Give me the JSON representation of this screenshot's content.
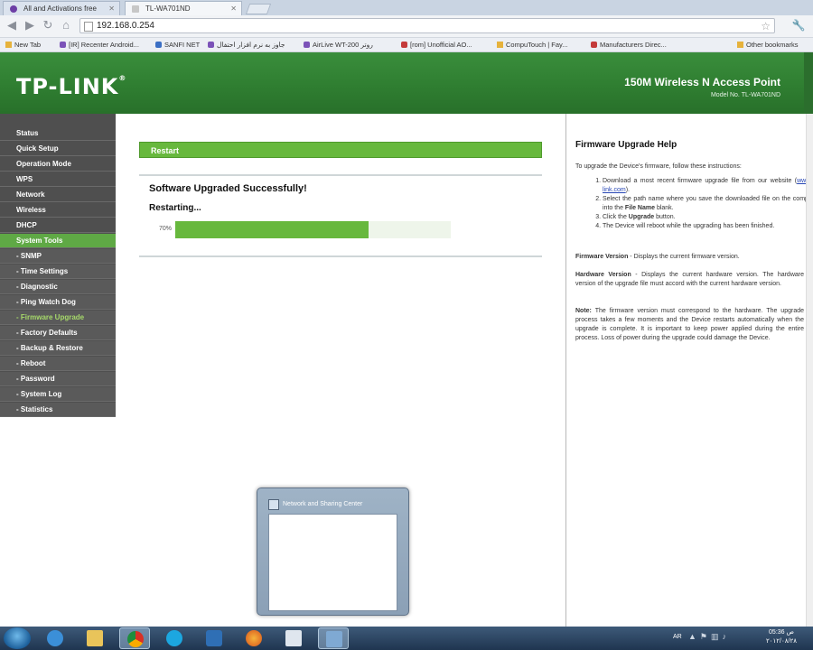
{
  "browser": {
    "tabs": [
      {
        "label": "All and Activations free"
      },
      {
        "label": "TL-WA701ND"
      }
    ],
    "address": "192.168.0.254",
    "bookmarks": [
      {
        "label": "New Tab"
      },
      {
        "label": "[IR] Recenter Android..."
      },
      {
        "label": "SANFI NET"
      },
      {
        "label": "جاوز به نرم افزار احتفال"
      },
      {
        "label": "AirLive WT-200 روتر"
      },
      {
        "label": "[rom] Unofficial AO..."
      },
      {
        "label": "CompuTouch | Fay..."
      },
      {
        "label": "Manufacturers Direc..."
      },
      {
        "label": "Other bookmarks"
      }
    ]
  },
  "header": {
    "logo": "TP-LINK",
    "product": "150M Wireless N Access Point",
    "model": "Model No. TL-WA701ND"
  },
  "sidebar": {
    "items": [
      {
        "label": "Status"
      },
      {
        "label": "Quick Setup"
      },
      {
        "label": "Operation Mode"
      },
      {
        "label": "WPS"
      },
      {
        "label": "Network"
      },
      {
        "label": "Wireless"
      },
      {
        "label": "DHCP"
      },
      {
        "label": "System Tools"
      },
      {
        "label": "- SNMP"
      },
      {
        "label": "- Time Settings"
      },
      {
        "label": "- Diagnostic"
      },
      {
        "label": "- Ping Watch Dog"
      },
      {
        "label": "- Firmware Upgrade"
      },
      {
        "label": "- Factory Defaults"
      },
      {
        "label": "- Backup & Restore"
      },
      {
        "label": "- Reboot"
      },
      {
        "label": "- Password"
      },
      {
        "label": "- System Log"
      },
      {
        "label": "- Statistics"
      }
    ]
  },
  "main": {
    "section_title": "Restart",
    "message": "Software Upgraded Successfully!",
    "status": "Restarting...",
    "progress_label": "70%",
    "progress": 0.7
  },
  "help": {
    "title": "Firmware Upgrade Help",
    "intro": "To upgrade the Device's firmware, follow these instructions:",
    "step1_a": "Download a most recent firmware upgrade file from our website (",
    "step1_link": "www.tp-link.com",
    "step1_b": ").",
    "step2_a": "Select the path name where you save the downloaded file on the computer into the ",
    "step2_bold": "File Name",
    "step2_b": " blank.",
    "step3_a": "Click the ",
    "step3_bold": "Upgrade",
    "step3_b": " button.",
    "step4": "The Device will reboot while the upgrading has been finished.",
    "fw_label": "Firmware Version",
    "fw_text": " - Displays the current firmware version.",
    "hw_label": "Hardware Version",
    "hw_text": " - Displays the current hardware version. The hardware version of the upgrade file must accord with the current hardware version.",
    "note_label": "Note:",
    "note_text": " The firmware version must correspond to the hardware. The upgrade process takes a few moments and the Device restarts automatically when the upgrade is complete. It is important to keep power applied during the entire process. Loss of power during the upgrade could damage the Device."
  },
  "popup": {
    "title": "Network and Sharing Center"
  },
  "taskbar": {
    "lang": "AR",
    "time": "05:36 ص",
    "date": "۲۰۱۲/۰۸/۲۸"
  }
}
